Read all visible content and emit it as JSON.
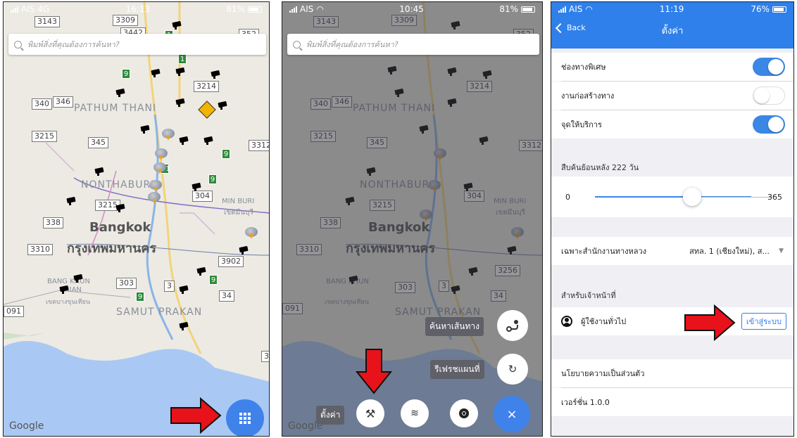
{
  "panel1": {
    "status": {
      "carrier": "AIS",
      "network": "4G",
      "time": "16:13",
      "battery": "81%"
    },
    "search_placeholder": "พิมพ์สิ่งที่คุณต้องการค้นหา?",
    "map_labels": {
      "pathum": "PATHUM THANI",
      "nontha": "NONTHABURI",
      "bangkok": "Bangkok",
      "bangkok_th": "กรุงเทพมหานคร",
      "minburi": "MIN BURI",
      "minburi_th": "เขตมีนบุรี",
      "bangkhun": "BANG KHUN",
      "thian": "THIAN",
      "bangkhun_th": "เขตบางขุนเทียน",
      "samut": "SAMUT PRAKAN"
    },
    "shields": [
      "3143",
      "3309",
      "3442",
      "352",
      "3214",
      "340",
      "346",
      "3215",
      "345",
      "3312",
      "304",
      "3215",
      "338",
      "3310",
      "3902",
      "303",
      "3",
      "34",
      "091",
      "3"
    ],
    "green_shields": [
      "1",
      "9",
      "9",
      "31",
      "9",
      "9",
      "9"
    ],
    "google": "Google"
  },
  "panel2": {
    "status": {
      "carrier": "AIS",
      "time": "10:45",
      "battery": "81%"
    },
    "search_placeholder": "พิมพ์สิ่งที่คุณต้องการค้นหา?",
    "menu": {
      "find_route": "ค้นหาเส้นทาง",
      "refresh_map": "รีเฟรชแผนที่",
      "settings": "ตั้งค่า"
    },
    "shields_extra": [
      "3256"
    ],
    "close_glyph": "×",
    "google": "Google"
  },
  "panel3": {
    "status": {
      "carrier": "AIS",
      "time": "11:19",
      "battery": "76%"
    },
    "nav": {
      "back": "Back",
      "title": "ตั้งค่า"
    },
    "toggles": [
      {
        "label": "ช่องทางพิเศษ",
        "on": true
      },
      {
        "label": "งานก่อสร้างทาง",
        "on": false
      },
      {
        "label": "จุดให้บริการ",
        "on": true
      }
    ],
    "history_header": "สืบค้นย้อนหลัง 222 วัน",
    "slider": {
      "min": "0",
      "max": "365",
      "value": 222
    },
    "office_label": "เฉพาะสำนักงานทางหลวง",
    "office_value": "สทล. 1 (เชียงใหม่), ส...",
    "staff_header": "สำหรับเจ้าหน้าที่",
    "user_label": "ผู้ใช้งานทั่วไป",
    "login_button": "เข้าสู่ระบบ",
    "privacy": "นโยบายความเป็นส่วนตัว",
    "version": "เวอร์ชั่น 1.0.0"
  },
  "colors": {
    "accent": "#2f80ea",
    "arrow": "#e8121a",
    "fab": "#3f82ea"
  }
}
